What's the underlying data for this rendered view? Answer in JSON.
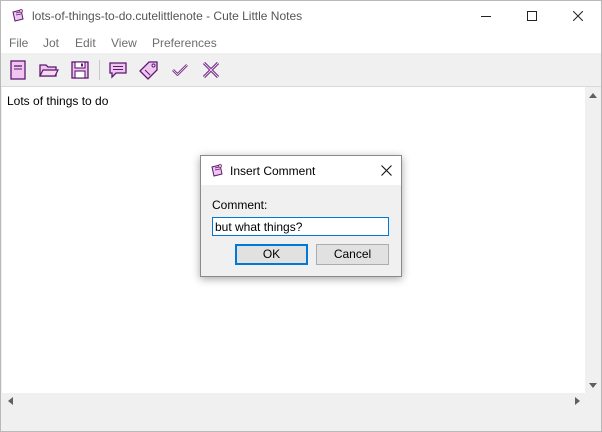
{
  "window": {
    "title": "lots-of-things-to-do.cutelittlenote - Cute Little Notes"
  },
  "menubar": {
    "items": [
      "File",
      "Jot",
      "Edit",
      "View",
      "Preferences"
    ]
  },
  "toolbar": {
    "buttons": [
      {
        "icon": "new-note-icon"
      },
      {
        "icon": "open-folder-icon"
      },
      {
        "icon": "save-disk-icon"
      },
      {
        "icon": "insert-comment-icon"
      },
      {
        "icon": "tag-icon"
      },
      {
        "icon": "check-icon"
      },
      {
        "icon": "cross-icon"
      }
    ]
  },
  "editor": {
    "content": "Lots of things to do"
  },
  "dialog": {
    "title": "Insert Comment",
    "label": "Comment:",
    "input_value": "but what things?",
    "ok_label": "OK",
    "cancel_label": "Cancel"
  },
  "colors": {
    "icon_fill": "#f0c6f0",
    "icon_stroke": "#5a1a6e"
  }
}
